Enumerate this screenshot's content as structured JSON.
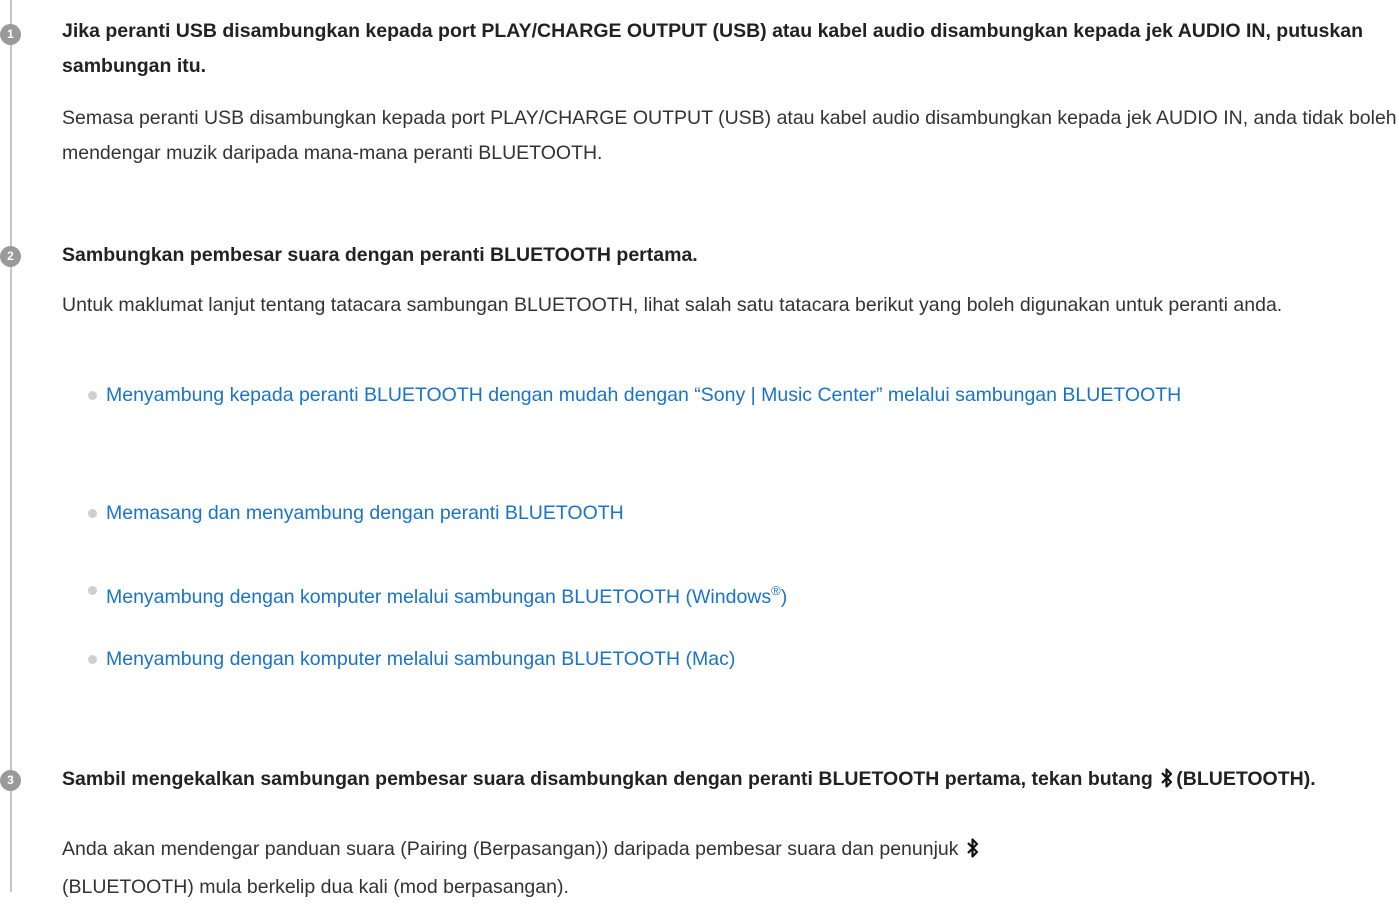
{
  "steps": [
    {
      "number": "1",
      "title": "Jika peranti USB disambungkan kepada port PLAY/CHARGE OUTPUT (USB) atau kabel audio disambungkan kepada jek AUDIO IN, putuskan sambungan itu.",
      "description": "Semasa peranti USB disambungkan kepada port PLAY/CHARGE OUTPUT (USB) atau kabel audio disambungkan kepada jek AUDIO IN, anda tidak boleh mendengar muzik daripada mana-mana peranti BLUETOOTH."
    },
    {
      "number": "2",
      "title": "Sambungkan pembesar suara dengan peranti BLUETOOTH pertama.",
      "description": "Untuk maklumat lanjut tentang tatacara sambungan BLUETOOTH, lihat salah satu tatacara berikut yang boleh digunakan untuk peranti anda.",
      "links": [
        {
          "text": "Menyambung kepada peranti BLUETOOTH dengan mudah dengan “Sony | Music Center” melalui sambungan BLUETOOTH"
        },
        {
          "text": "Memasang dan menyambung dengan peranti BLUETOOTH"
        },
        {
          "text": "Menyambung dengan komputer melalui sambungan BLUETOOTH (Windows",
          "sup": "®",
          "suffix": ")"
        },
        {
          "text": "Menyambung dengan komputer melalui sambungan BLUETOOTH (Mac)"
        }
      ]
    },
    {
      "number": "3",
      "title_part1": "Sambil mengekalkan sambungan pembesar suara disambungkan dengan peranti BLUETOOTH pertama, tekan butang",
      "title_part2": "(BLUETOOTH).",
      "description_part1": "Anda akan mendengar panduan suara (Pairing (Berpasangan)) daripada pembesar suara dan penunjuk",
      "description_part2": "(BLUETOOTH) mula berkelip dua kali (mod berpasangan)."
    }
  ],
  "icons": {
    "bluetooth": "bluetooth-icon"
  },
  "colors": {
    "link": "#1a73c9",
    "badge": "#9a9a9a",
    "timeline": "#c6c6c6"
  }
}
